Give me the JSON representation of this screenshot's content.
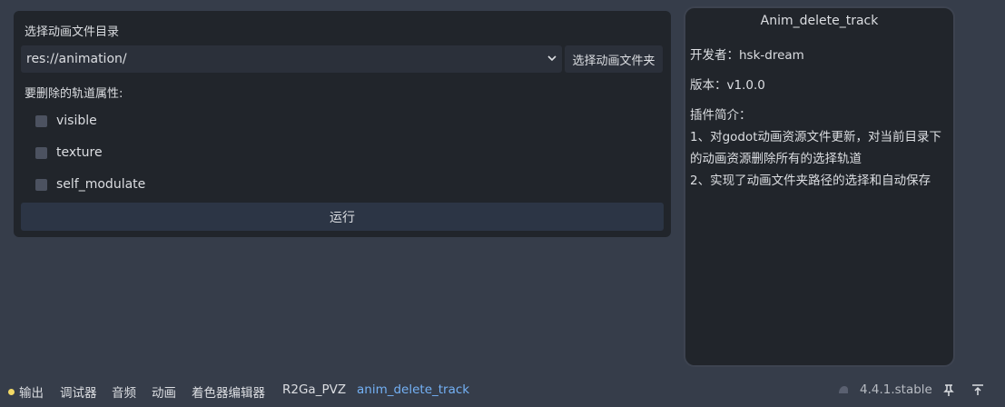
{
  "left_panel": {
    "dir_section_label": "选择动画文件目录",
    "dir_value": "res://animation/",
    "choose_button": "选择动画文件夹",
    "props_label": "要删除的轨道属性:",
    "properties": [
      "visible",
      "texture",
      "self_modulate"
    ],
    "run_button": "运行"
  },
  "info_panel": {
    "title": "Anim_delete_track",
    "developer": "开发者：hsk-dream",
    "version": "版本：v1.0.0",
    "intro_label": "插件简介：",
    "intro_lines": [
      "1、对godot动画资源文件更新，对当前目录下",
      "的动画资源删除所有的选择轨道",
      "2、实现了动画文件夹路径的选择和自动保存"
    ]
  },
  "bottom_bar": {
    "tabs": [
      "输出",
      "调试器",
      "音频",
      "动画",
      "着色器编辑器",
      "R2Ga_PVZ",
      "anim_delete_track"
    ],
    "active_tab": "anim_delete_track",
    "version": "4.4.1.stable"
  },
  "colors": {
    "background": "#363d4a",
    "panel": "#21252b",
    "active_tab": "#74b1f5",
    "output_dot": "#f2d966"
  },
  "icons": [
    "chevron-down-icon",
    "godot-icon",
    "pin-icon",
    "bottom-panel-icon"
  ]
}
